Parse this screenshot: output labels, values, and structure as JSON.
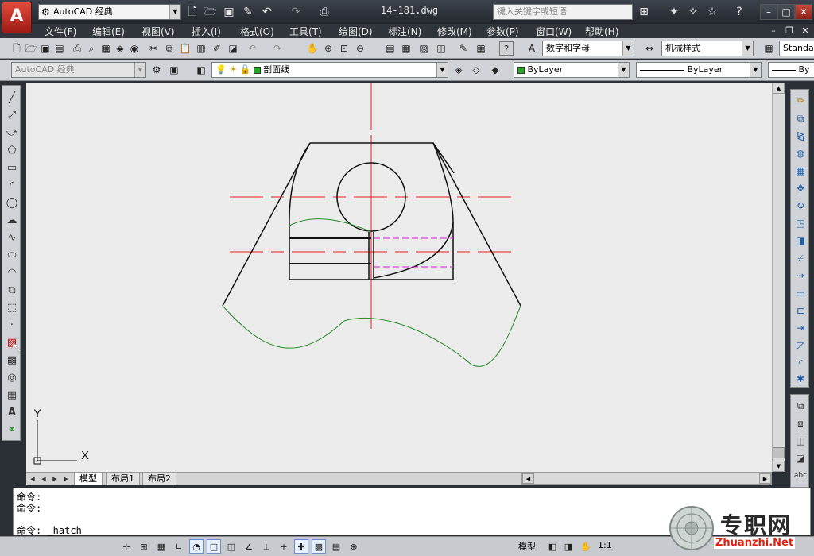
{
  "titlebar": {
    "app_logo": "A",
    "workspace": "AutoCAD 经典",
    "document": "14-181.dwg",
    "search_placeholder": "键入关键字或短语"
  },
  "menus": [
    "文件(F)",
    "编辑(E)",
    "视图(V)",
    "插入(I)",
    "格式(O)",
    "工具(T)",
    "绘图(D)",
    "标注(N)",
    "修改(M)",
    "参数(P)",
    "窗口(W)",
    "帮助(H)"
  ],
  "toolbar": {
    "text_style": "数字和字母",
    "dim_style": "机械样式",
    "table_style": "Standa"
  },
  "layers_bar": {
    "workspace": "AutoCAD 经典",
    "current_layer": "剖面线",
    "color": "ByLayer",
    "linetype": "ByLayer",
    "lineweight": "By"
  },
  "ucs": {
    "x_label": "X",
    "y_label": "Y"
  },
  "tabs": [
    "模型",
    "布局1",
    "布局2"
  ],
  "commands": [
    "命令:",
    "命令:",
    "命令: _hatch"
  ],
  "status": {
    "model": "模型",
    "scale": "1:1"
  },
  "watermark": {
    "brand": "专职网",
    "url": "Zhuanzhi.Net"
  },
  "colors": {
    "canvas_bg": "#ebebeb",
    "centerline": "#e02020",
    "hidden_line": "#d020d0",
    "break_line": "#2a8a2a",
    "object_line": "#111111",
    "layer_swatch": "#22aa22"
  }
}
